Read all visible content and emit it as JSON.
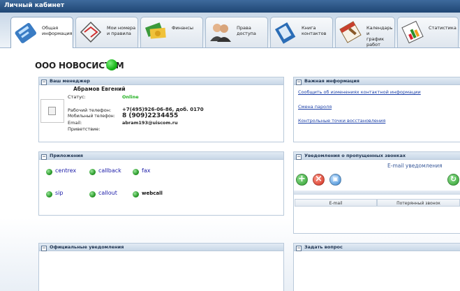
{
  "header": {
    "title": "Личный кабинет"
  },
  "tabs": [
    {
      "label": "Общая\nинформация",
      "icon": "info-icon"
    },
    {
      "label": "Мои номера\nи правила",
      "icon": "routes-icon"
    },
    {
      "label": "Финансы",
      "icon": "finance-icon"
    },
    {
      "label": "Права\nдоступа",
      "icon": "users-icon"
    },
    {
      "label": "Книга\nконтактов",
      "icon": "contacts-icon"
    },
    {
      "label": "Календарь и\nграфик работ",
      "icon": "calendar-icon"
    },
    {
      "label": "Статистика",
      "icon": "statistics-icon"
    }
  ],
  "company": {
    "name": "ООО НОВОСИСТЕМ",
    "status_color": "#22bb22"
  },
  "manager": {
    "title": "Ваш менеджер",
    "name": "Абрамов Евгений",
    "status_label": "Статус:",
    "status_value": "Online",
    "work_phone_label": "Рабочий телефон:",
    "work_phone": "+7(495)926-06-86, доб. 0170",
    "mobile_label": "Мобильный телефон:",
    "mobile": "8 (909)2234455",
    "email_label": "Email:",
    "email": "abram193@uiscom.ru",
    "greeting_label": "Приветствие:"
  },
  "important": {
    "title": "Важная информация",
    "links": [
      "Сообщить об изменениях контактной информации",
      "Смена пароля",
      "Контрольные точки восстановления"
    ]
  },
  "apps": {
    "title": "Приложения",
    "items": [
      "centrex",
      "callback",
      "fax",
      "sip",
      "callout",
      "webcall"
    ]
  },
  "missed": {
    "title": "Уведомления о пропущенных звонках",
    "subtitle": "E-mail уведомления",
    "columns": [
      "E-mail",
      "Потерянный звонок"
    ]
  },
  "notices": {
    "title": "Официальные уведомления"
  },
  "ask": {
    "title": "Задать вопрос"
  }
}
